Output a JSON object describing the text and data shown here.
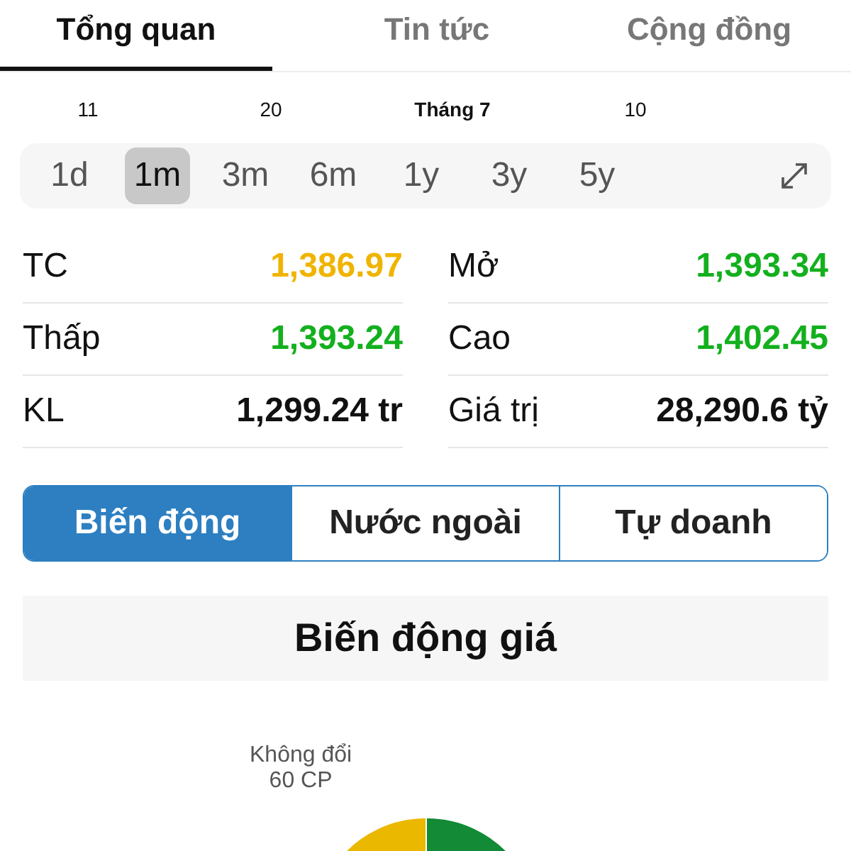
{
  "tabs": [
    {
      "label": "Tổng quan",
      "selected": true
    },
    {
      "label": "Tin tức",
      "selected": false
    },
    {
      "label": "Cộng đồng",
      "selected": false
    }
  ],
  "axis_labels": [
    {
      "label": "11",
      "bold": false
    },
    {
      "label": "20",
      "bold": false
    },
    {
      "label": "Tháng 7",
      "bold": true
    },
    {
      "label": "10",
      "bold": false
    }
  ],
  "periods": [
    {
      "label": "1d",
      "selected": false
    },
    {
      "label": "1m",
      "selected": true
    },
    {
      "label": "3m",
      "selected": false
    },
    {
      "label": "6m",
      "selected": false
    },
    {
      "label": "1y",
      "selected": false
    },
    {
      "label": "3y",
      "selected": false
    },
    {
      "label": "5y",
      "selected": false
    }
  ],
  "stats": [
    {
      "label": "TC",
      "value": "1,386.97",
      "color": "#f0b400"
    },
    {
      "label": "Mở",
      "value": "1,393.34",
      "color": "#13b01e"
    },
    {
      "label": "Thấp",
      "value": "1,393.24",
      "color": "#13b01e"
    },
    {
      "label": "Cao",
      "value": "1,402.45",
      "color": "#13b01e"
    },
    {
      "label": "KL",
      "value": "1,299.24 tr",
      "color": "#111111"
    },
    {
      "label": "Giá trị",
      "value": "28,290.6 tỷ",
      "color": "#111111"
    }
  ],
  "segments": [
    {
      "label": "Biến động",
      "selected": true
    },
    {
      "label": "Nước ngoài",
      "selected": false
    },
    {
      "label": "Tự doanh",
      "selected": false
    }
  ],
  "section_title": "Biến động giá",
  "pie_label": {
    "name": "Không đổi",
    "count": "60 CP"
  }
}
